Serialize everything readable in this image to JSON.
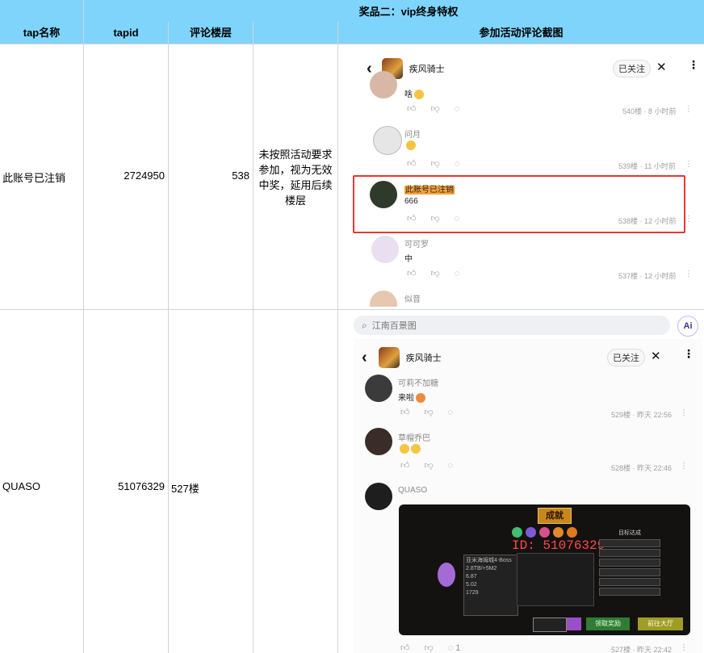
{
  "banner": "奖品二：vip终身特权",
  "headers": [
    "tap名称",
    "tapid",
    "评论楼层",
    "",
    "参加活动评论截图"
  ],
  "rows": [
    {
      "tap_name": "此账号已注销",
      "tapid": "2724950",
      "floor": "538",
      "note": "未按照活动要求参加，视为无效中奖，延用后续楼层"
    },
    {
      "tap_name": "QUASO",
      "tapid": "51076329",
      "floor": "527楼",
      "note": ""
    }
  ],
  "shot1": {
    "user": "疾风骑士",
    "follow": "已关注",
    "comments": [
      {
        "name": "",
        "text": "啥",
        "meta": "540楼 · 8 小时前"
      },
      {
        "name": "问月",
        "text": "",
        "meta": "539楼 · 11 小时前"
      },
      {
        "name": "此账号已注销",
        "text": "666",
        "meta": "538楼 · 12 小时前"
      },
      {
        "name": "可可罗",
        "text": "中",
        "meta": "537楼 · 12 小时前"
      },
      {
        "name": "似音",
        "text": "",
        "meta": ""
      }
    ]
  },
  "shot2": {
    "search_placeholder": "江南百景图",
    "ai": "Ai",
    "user": "疾风骑士",
    "follow": "已关注",
    "comments": [
      {
        "name": "可莉不加糖",
        "text": "来啦",
        "meta": "529楼 · 昨天 22:56"
      },
      {
        "name": "草帽乔巴",
        "text": "",
        "meta": "528楼 · 昨天 22:46"
      },
      {
        "name": "QUASO",
        "text": "",
        "meta": "527楼 · 昨天 22:42"
      }
    ],
    "reply_count": "1",
    "game": {
      "title": "成就",
      "id_text": "ID: 51076329",
      "boss": "亚米海姆城4-Boss",
      "stats": [
        "4/7",
        "1/1",
        "2/10",
        "2/5",
        "0/3"
      ],
      "value1": "2.8TB/+5M2",
      "value2": "6.87",
      "value3": "5.02",
      "value4": "1729",
      "goal_title": "目标达成",
      "btn_claim": "领取奖励",
      "btn_lobby": "前往大厅"
    }
  },
  "colors": {
    "header_bg": "#7fd4fb",
    "grid": "#d4d4d4",
    "highlight_box": "#e53935",
    "name_highlight": "#f7a23b"
  }
}
